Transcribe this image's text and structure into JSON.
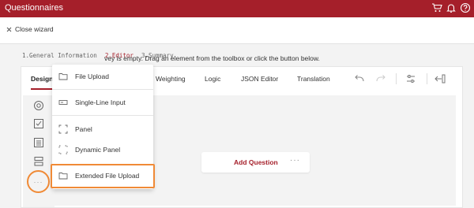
{
  "topbar": {
    "title": "Questionnaires",
    "icons": [
      "cart-icon",
      "bell-icon",
      "help-icon"
    ]
  },
  "wizard": {
    "close_label": "Close wizard"
  },
  "steps": [
    {
      "label": "1.General Information"
    },
    {
      "label": "2.Editor",
      "active": true
    },
    {
      "label": "3.Summary"
    }
  ],
  "tabs": [
    {
      "label": "Design",
      "active": true
    },
    {
      "label": "Weighting"
    },
    {
      "label": "Logic"
    },
    {
      "label": "JSON Editor"
    },
    {
      "label": "Translation"
    }
  ],
  "toolbar_icons": [
    "undo-icon",
    "redo-icon",
    "settings-icon",
    "collapse-panel-icon"
  ],
  "toolbox_icons": [
    "radio-icon",
    "checkbox-icon",
    "dropdown-icon",
    "panel-icon",
    "more-icon"
  ],
  "canvas": {
    "empty_message": "vey is empty. Drag an element from the toolbox or click the button below.",
    "add_question": "Add Question",
    "more": "···"
  },
  "menu": {
    "items": [
      {
        "label": "File Upload",
        "icon": "folder-icon"
      },
      {
        "label": "Single-Line Input",
        "icon": "input-icon"
      },
      {
        "label": "Panel",
        "icon": "panel-icon"
      },
      {
        "label": "Dynamic Panel",
        "icon": "dynamic-panel-icon"
      },
      {
        "label": "Extended File Upload",
        "icon": "folder-icon",
        "highlighted": true
      }
    ]
  },
  "colors": {
    "brand": "#a51f2a",
    "highlight": "#f08a36"
  }
}
